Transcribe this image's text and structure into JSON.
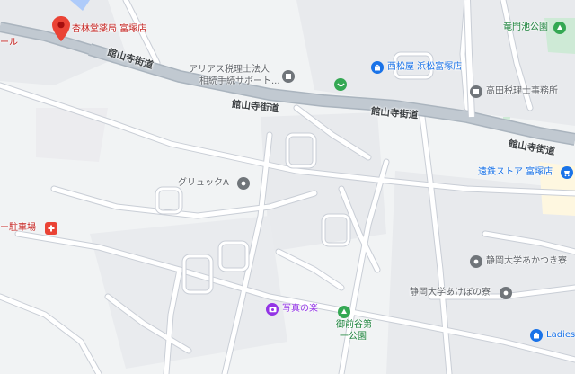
{
  "map": {
    "colors": {
      "background": "#f1f3f4",
      "block": "#e8eaed",
      "road_fill": "#ffffff",
      "road_casing": "#c3c8cf",
      "major_road": "#aab4be",
      "water": "#aecbfa",
      "park": "#ceead6",
      "commercial": "#fef7e0"
    },
    "places": [
      {
        "label": "杏林堂薬局 富塚店",
        "icon": "map-pin-icon",
        "color": "#ea4335",
        "kind": "pharmacy"
      },
      {
        "label": "アリアス税理士法人",
        "icon": "office-icon",
        "color": "#5f6368",
        "kind": "office"
      },
      {
        "label": "相続手続サポート...",
        "icon": "office-icon",
        "color": "#5f6368",
        "kind": "office"
      },
      {
        "label": "西松屋 浜松富塚店",
        "icon": "shopping-bag-icon",
        "color": "#1a73e8",
        "kind": "shop"
      },
      {
        "label": "竜門池公園",
        "icon": "park-icon",
        "color": "#188038",
        "kind": "park"
      },
      {
        "label": "高田税理士事務所",
        "icon": "office-icon",
        "color": "#5f6368",
        "kind": "office"
      },
      {
        "label": "遠鉄ストア 富塚店",
        "icon": "shopping-cart-icon",
        "color": "#1a73e8",
        "kind": "shop"
      },
      {
        "label": "グリュックA",
        "icon": "building-icon",
        "color": "#5f6368",
        "kind": "building"
      },
      {
        "label": "ー駐車場",
        "icon": "hospital-icon",
        "color": "#ea4335",
        "kind": "hospital"
      },
      {
        "label": "静岡大学あかつき寮",
        "icon": "building-icon",
        "color": "#5f6368",
        "kind": "building"
      },
      {
        "label": "静岡大学あけぼの寮",
        "icon": "building-icon",
        "color": "#5f6368",
        "kind": "building"
      },
      {
        "label": "写真の楽",
        "icon": "camera-icon",
        "color": "#9334e6",
        "kind": "photo"
      },
      {
        "label": "御前谷第",
        "icon": "park-icon",
        "color": "#188038",
        "kind": "park"
      },
      {
        "label": "一公園",
        "icon": "",
        "color": "#188038",
        "kind": "park"
      },
      {
        "label": "Ladies",
        "icon": "shopping-bag-icon",
        "color": "#1a73e8",
        "kind": "shop"
      },
      {
        "label": "ール",
        "icon": "",
        "color": "#c5221f",
        "kind": "cut-off"
      },
      {
        "label": "",
        "icon": "restaurant-icon",
        "color": "#34a853",
        "kind": "restaurant"
      }
    ],
    "roads": [
      {
        "label": "館山寺街道"
      },
      {
        "label": "館山寺街道"
      },
      {
        "label": "館山寺街道"
      },
      {
        "label": "館山寺街道"
      }
    ]
  }
}
